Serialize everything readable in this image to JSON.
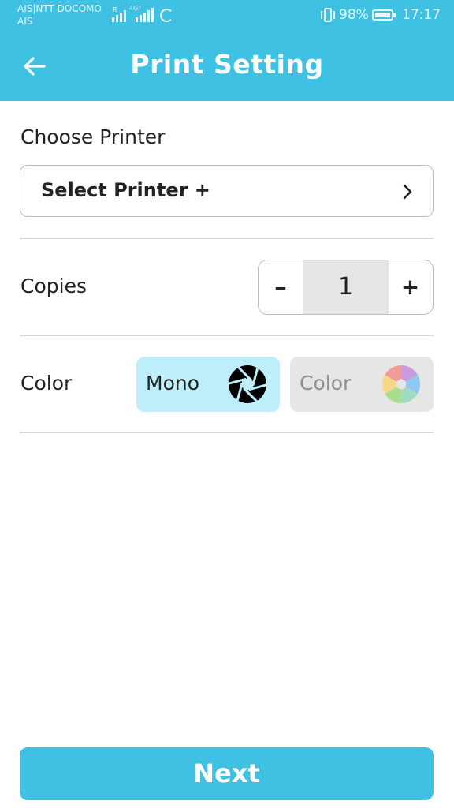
{
  "status_bar": {
    "carrier_line1": "AIS|NTT DOCOMO",
    "carrier_line2": "AIS",
    "signal1_tag": "R",
    "signal2_tag": "4G⁺",
    "battery_text": "98%",
    "time": "17:17"
  },
  "header": {
    "title": "Print Setting",
    "back_icon": "arrow-left-icon"
  },
  "printer": {
    "section_label": "Choose Printer",
    "select_label": "Select Printer +",
    "chevron_icon": "chevron-right-icon"
  },
  "copies": {
    "label": "Copies",
    "minus": "–",
    "value": "1",
    "plus": "+"
  },
  "color": {
    "label": "Color",
    "options": [
      {
        "label": "Mono",
        "icon": "aperture-black-icon",
        "selected": true
      },
      {
        "label": "Color",
        "icon": "aperture-color-icon",
        "selected": false
      }
    ]
  },
  "footer": {
    "next_label": "Next"
  },
  "colors": {
    "accent": "#3ec1e3",
    "selected_option_bg": "#bfeefb",
    "unselected_option_bg": "#e6e6e6"
  }
}
